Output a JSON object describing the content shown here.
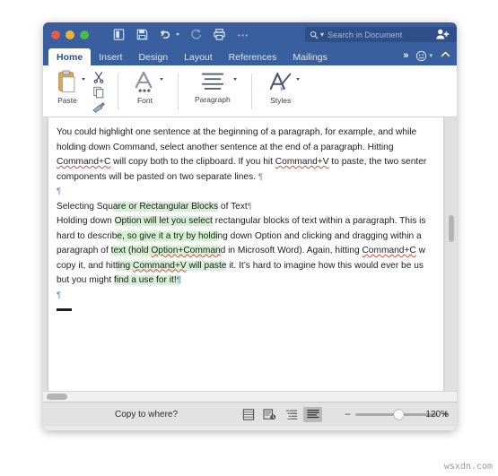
{
  "window": {
    "titlebar": {
      "traffic_lights": [
        "close",
        "minimize",
        "maximize"
      ],
      "quick_access": [
        {
          "name": "new-document-icon",
          "label": "New Document",
          "enabled": true
        },
        {
          "name": "save-icon",
          "label": "Save",
          "enabled": true
        },
        {
          "name": "undo-icon",
          "label": "Undo",
          "enabled": true
        },
        {
          "name": "redo-icon",
          "label": "Redo",
          "enabled": false
        },
        {
          "name": "print-icon",
          "label": "Print",
          "enabled": true
        },
        {
          "name": "overflow-icon",
          "label": "More",
          "enabled": true
        }
      ],
      "search": {
        "placeholder": "Search in Document",
        "value": ""
      },
      "share_label": "Share"
    },
    "tabs": [
      {
        "label": "Home",
        "active": true
      },
      {
        "label": "Insert",
        "active": false
      },
      {
        "label": "Design",
        "active": false
      },
      {
        "label": "Layout",
        "active": false
      },
      {
        "label": "References",
        "active": false
      },
      {
        "label": "Mailings",
        "active": false
      }
    ],
    "tab_overflow": "»",
    "tab_right_icons": [
      {
        "name": "smiley-icon",
        "label": "Tell me / Feedback"
      },
      {
        "name": "collapse-ribbon-icon",
        "label": "Collapse Ribbon"
      }
    ]
  },
  "ribbon": {
    "groups": [
      {
        "name": "clipboard",
        "main": {
          "label": "Paste",
          "icon": "paste-icon"
        },
        "mini": [
          {
            "label": "Cut",
            "icon": "cut-icon"
          },
          {
            "label": "Copy",
            "icon": "copy-icon"
          },
          {
            "label": "Format Painter",
            "icon": "format-painter-icon"
          }
        ]
      },
      {
        "name": "font",
        "main": {
          "label": "Font",
          "icon": "font-icon"
        },
        "mini": []
      },
      {
        "name": "paragraph",
        "main": {
          "label": "Paragraph",
          "icon": "paragraph-icon"
        },
        "mini": []
      },
      {
        "name": "styles",
        "main": {
          "label": "Styles",
          "icon": "styles-icon"
        },
        "mini": []
      }
    ]
  },
  "document": {
    "paragraph1": {
      "line1": "You could highlight one sentence at the beginning of a paragraph, for example, and while",
      "line2": "holding down Command, select another sentence at the end of a paragraph. Hitting",
      "line3_a": "Command+C",
      "line3_b": " will copy both to the clipboard. If you hit ",
      "line3_c": "Command+V",
      "line3_d": " to paste, the two senter",
      "line4": "components will be pasted on two separate lines."
    },
    "heading": {
      "plain": "Selecting Squ",
      "highlighted": "are or Rectangular Blocks",
      "tail": " of Text"
    },
    "paragraph2": {
      "l1_a": "Holding down ",
      "l1_hl": "Option will let you select",
      "l1_b": " rectangular blocks of text within a paragraph. This i",
      "l1_c": "s",
      "l2_a": "hard to describ",
      "l2_hl": "e, so give it a try by holdi",
      "l2_b": "ng down Option and clicking and dragging within a",
      "l3_a": "paragraph of ",
      "l3_hl_1": "text (hold ",
      "l3_hl_sq": "Option+Comman",
      "l3_b": "d in Microsoft Word). Again, hitting ",
      "l3_sq2": "Command+C",
      "l3_c": " w",
      "l4_a": "copy it, and hit",
      "l4_hl_1": "ting ",
      "l4_hl_sq": "Command+V",
      "l4_hl_2": " will paste",
      "l4_b": " it. It’s hard to imagine how this would ever be us",
      "l5_a": "but you might ",
      "l5_hl": "find a use for it!"
    },
    "pilcrow": "¶",
    "scrollbars": {
      "vertical": "document-vertical-scrollbar",
      "horizontal": "document-horizontal-scrollbar"
    }
  },
  "statusbar": {
    "status_text": "Copy to where?",
    "view_modes": [
      {
        "name": "view-mode-print-layout-grid",
        "selected": false
      },
      {
        "name": "view-mode-web-layout",
        "selected": false
      },
      {
        "name": "view-mode-outline",
        "selected": false
      },
      {
        "name": "view-mode-draft",
        "selected": true
      }
    ],
    "zoom_out": "−",
    "zoom_in": "+",
    "zoom_level": "120%",
    "zoom_thumb_percent": 52
  },
  "watermark": "wsxdn.com",
  "colors": {
    "titlebar_blue": "#3a5f9e",
    "search_field": "#2e4f88",
    "active_tab_text": "#2c4f87",
    "highlight_green": "#d6f0d4",
    "spellcheck_red": "#d24b3e",
    "pilcrow_blue": "#5b8ec9"
  }
}
